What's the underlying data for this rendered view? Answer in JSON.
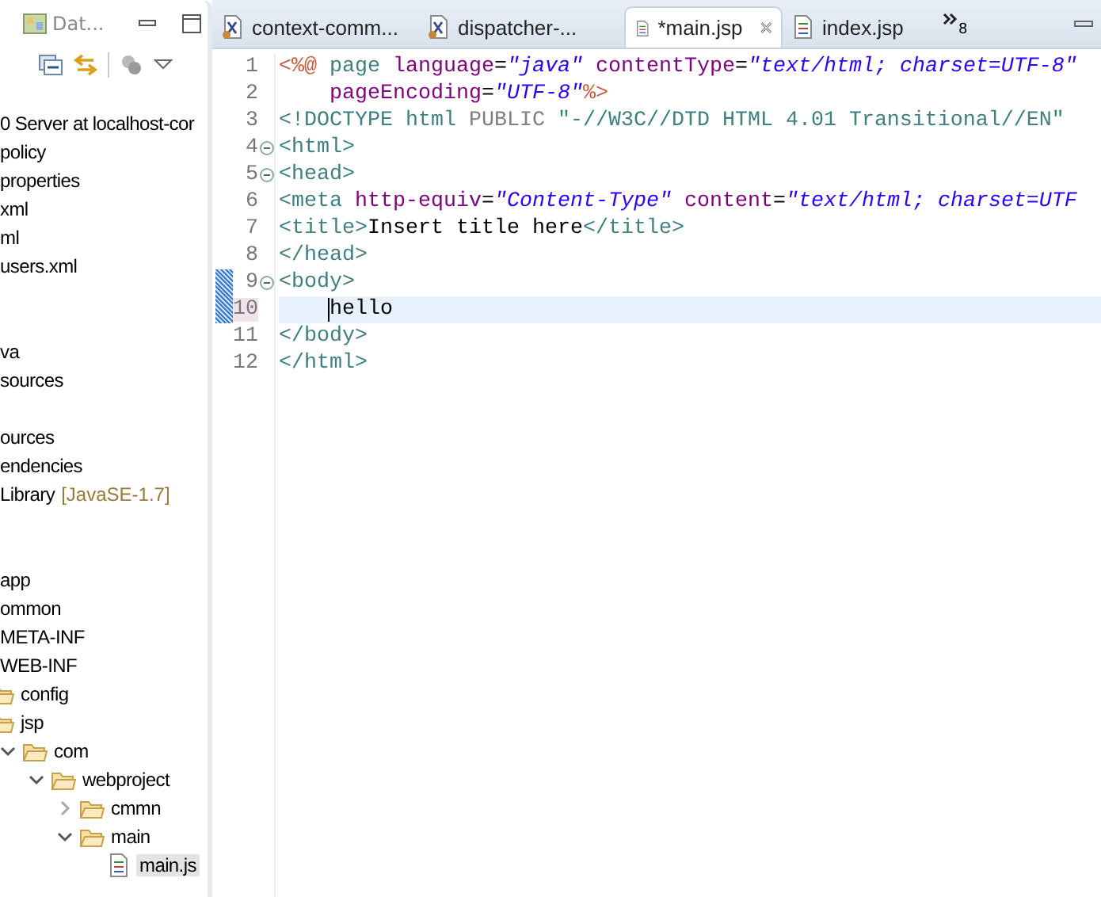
{
  "explorer": {
    "tab": {
      "label": "Dat..."
    },
    "tree": [
      {
        "kind": "label",
        "text": "0 Server at localhost-cor"
      },
      {
        "kind": "label",
        "text": "policy"
      },
      {
        "kind": "label",
        "text": "properties"
      },
      {
        "kind": "label",
        "text": "xml"
      },
      {
        "kind": "label",
        "text": "ml"
      },
      {
        "kind": "label",
        "text": "users.xml"
      },
      {
        "kind": "blank"
      },
      {
        "kind": "blank"
      },
      {
        "kind": "label",
        "text": "va"
      },
      {
        "kind": "label",
        "text": "sources"
      },
      {
        "kind": "blank"
      },
      {
        "kind": "label",
        "text": "ources"
      },
      {
        "kind": "label",
        "text": "endencies"
      },
      {
        "kind": "label",
        "text": "Library",
        "decoration": "[JavaSE-1.7]"
      },
      {
        "kind": "blank"
      },
      {
        "kind": "blank"
      },
      {
        "kind": "label",
        "text": "app"
      },
      {
        "kind": "label",
        "text": "ommon"
      },
      {
        "kind": "label",
        "text": "META-INF"
      },
      {
        "kind": "label",
        "text": "WEB-INF"
      },
      {
        "kind": "folder",
        "text": "config"
      },
      {
        "kind": "folder",
        "text": "jsp",
        "children": [
          {
            "kind": "folder",
            "text": "com",
            "expanded": true,
            "children": [
              {
                "kind": "folder",
                "text": "webproject",
                "expanded": true,
                "children": [
                  {
                    "kind": "folder",
                    "text": "cmmn",
                    "expanded": false
                  },
                  {
                    "kind": "folder",
                    "text": "main",
                    "expanded": true,
                    "children": [
                      {
                        "kind": "file",
                        "text": "main.js",
                        "selected": true
                      }
                    ]
                  }
                ]
              }
            ]
          }
        ]
      }
    ]
  },
  "editor": {
    "tabs": [
      {
        "label": "context-comm...",
        "kind": "xml",
        "selected": false
      },
      {
        "label": "dispatcher-...",
        "kind": "xml",
        "selected": false
      },
      {
        "label": "*main.jsp",
        "kind": "jsp",
        "selected": true
      },
      {
        "label": "index.jsp",
        "kind": "jsp",
        "selected": false
      }
    ],
    "overflow_count": "8",
    "lines": [
      {
        "number": "1",
        "foldable": false,
        "current": false,
        "tokens": [
          {
            "kind": "delim",
            "text": "<%@"
          },
          {
            "kind": "directive",
            "text": " page"
          },
          {
            "kind": "attr",
            "text": " language"
          },
          {
            "kind": "plain",
            "text": "="
          },
          {
            "kind": "value",
            "text": "\"java\""
          },
          {
            "kind": "attr",
            "text": " contentType"
          },
          {
            "kind": "plain",
            "text": "="
          },
          {
            "kind": "value",
            "text": "\"text/html; charset=UTF-8\""
          }
        ]
      },
      {
        "number": "2",
        "foldable": false,
        "current": false,
        "tokens": [
          {
            "kind": "attr",
            "text": "    pageEncoding"
          },
          {
            "kind": "plain",
            "text": "="
          },
          {
            "kind": "value",
            "text": "\"UTF-8\""
          },
          {
            "kind": "delim",
            "text": "%>"
          }
        ]
      },
      {
        "number": "3",
        "foldable": false,
        "current": false,
        "tokens": [
          {
            "kind": "tag",
            "text": "<!DOCTYPE html"
          },
          {
            "kind": "keyword",
            "text": " PUBLIC "
          },
          {
            "kind": "string",
            "text": "\"-//W3C//DTD HTML 4.01 Transitional//EN\""
          }
        ]
      },
      {
        "number": "4",
        "foldable": true,
        "current": false,
        "tokens": [
          {
            "kind": "tag",
            "text": "<html>"
          }
        ]
      },
      {
        "number": "5",
        "foldable": true,
        "current": false,
        "tokens": [
          {
            "kind": "tag",
            "text": "<head>"
          }
        ]
      },
      {
        "number": "6",
        "foldable": false,
        "current": false,
        "tokens": [
          {
            "kind": "tag",
            "text": "<meta"
          },
          {
            "kind": "attr",
            "text": " http-equiv"
          },
          {
            "kind": "plain",
            "text": "="
          },
          {
            "kind": "value",
            "text": "\"Content-Type\""
          },
          {
            "kind": "attr",
            "text": " content"
          },
          {
            "kind": "plain",
            "text": "="
          },
          {
            "kind": "value",
            "text": "\"text/html; charset=UTF"
          }
        ]
      },
      {
        "number": "7",
        "foldable": false,
        "current": false,
        "tokens": [
          {
            "kind": "tag",
            "text": "<title>"
          },
          {
            "kind": "plain",
            "text": "Insert title here"
          },
          {
            "kind": "tag",
            "text": "</title>"
          }
        ]
      },
      {
        "number": "8",
        "foldable": false,
        "current": false,
        "tokens": [
          {
            "kind": "tag",
            "text": "</head>"
          }
        ]
      },
      {
        "number": "9",
        "foldable": true,
        "current": false,
        "tokens": [
          {
            "kind": "tag",
            "text": "<body>"
          }
        ]
      },
      {
        "number": "10",
        "foldable": false,
        "current": true,
        "tokens": [
          {
            "kind": "plain",
            "text": "    hello"
          }
        ]
      },
      {
        "number": "11",
        "foldable": false,
        "current": false,
        "tokens": [
          {
            "kind": "tag",
            "text": "</body>"
          }
        ]
      },
      {
        "number": "12",
        "foldable": false,
        "current": false,
        "tokens": [
          {
            "kind": "tag",
            "text": "</html>"
          }
        ]
      }
    ]
  }
}
